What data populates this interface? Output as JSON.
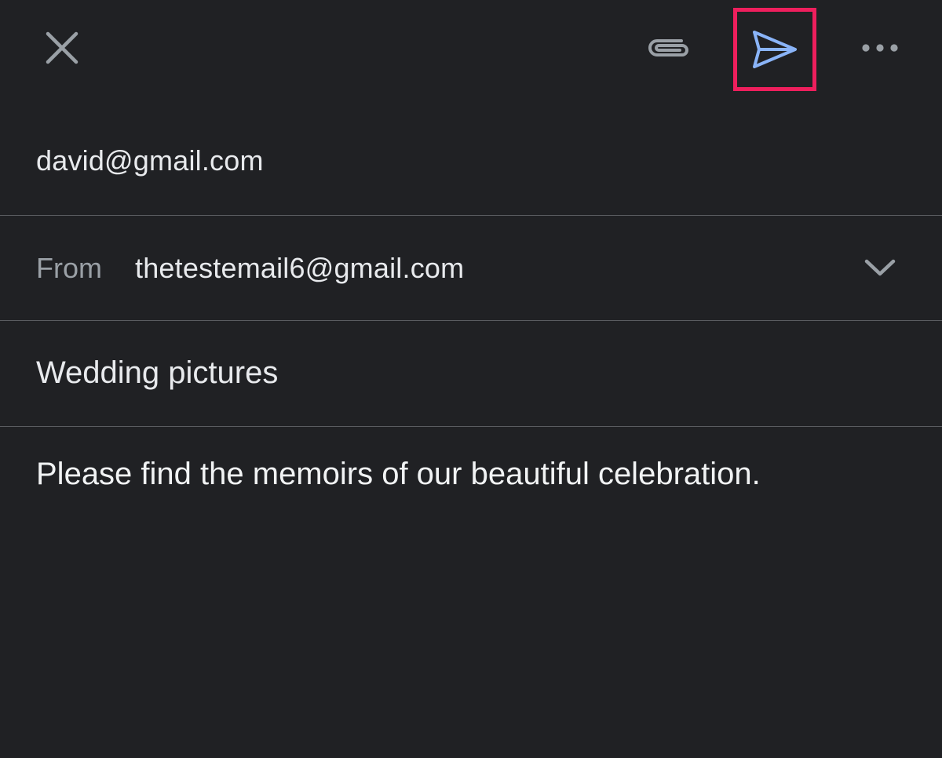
{
  "compose": {
    "to_value": "david@gmail.com",
    "from_label": "From",
    "from_value": "thetestemail6@gmail.com",
    "subject_value": "Wedding pictures",
    "body_value": "Please find the memoirs of our beautiful celebration."
  },
  "icons": {
    "close": "close-icon",
    "attach": "paperclip-icon",
    "send": "send-icon",
    "more": "more-horizontal-icon",
    "from_dropdown": "chevron-down-icon"
  },
  "colors": {
    "background": "#202124",
    "text": "#e8eaed",
    "muted_text": "#9aa0a6",
    "send_icon": "#8ab4f8",
    "highlight_border": "#ee1f5d",
    "divider": "#5a5c60"
  }
}
